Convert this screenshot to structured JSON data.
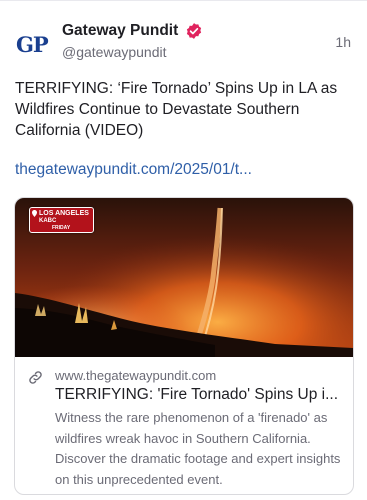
{
  "post": {
    "author_name": "Gateway Pundit",
    "author_handle": "@gatewaypundit",
    "avatar_text": "GP",
    "time": "1h",
    "text": "TERRIFYING: ‘Fire Tornado’ Spins Up in LA as Wildfires Continue to Devastate Southern California (VIDEO)",
    "link_text": "thegatewaypundit.com/2025/01/t..."
  },
  "card": {
    "domain": "www.thegatewaypundit.com",
    "title": "TERRIFYING: 'Fire Tornado' Spins Up i...",
    "description": "Witness the rare phenomenon of a 'firenado' as wildfires wreak havoc in Southern California. Discover the dramatic footage and expert insights on this unprecedented event.",
    "image_badge": {
      "line1": "LOS ANGELES",
      "line2": "KABC",
      "line3": "FRIDAY"
    }
  },
  "icons": {
    "verified": "verified-check-icon",
    "link": "link-icon"
  },
  "colors": {
    "link": "#2f5fa8",
    "verified_badge": "#e0245e",
    "avatar_text": "#1a3f8f",
    "secondary_text": "#6b6b76"
  }
}
